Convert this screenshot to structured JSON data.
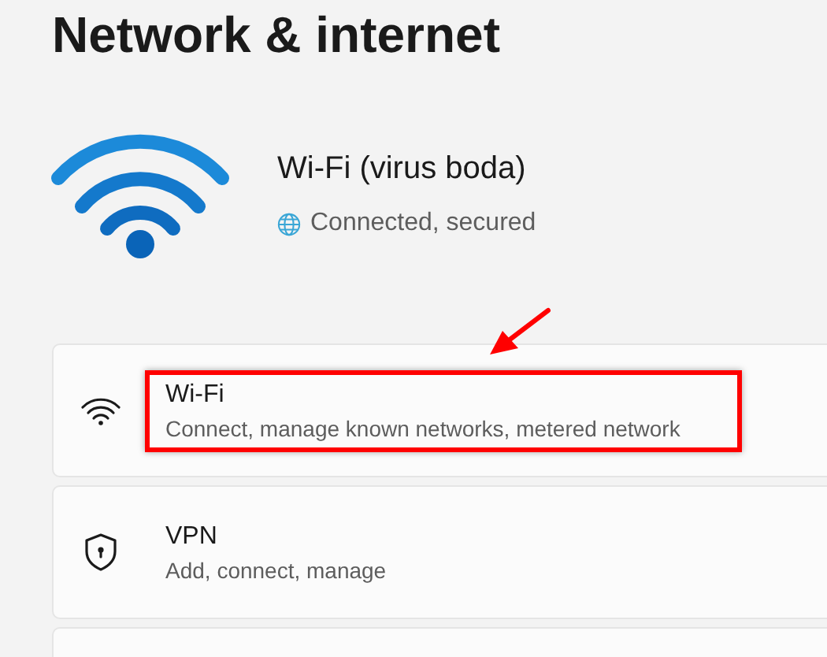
{
  "page_title": "Network & internet",
  "connection": {
    "name": "Wi-Fi (virus boda)",
    "status": "Connected, secured"
  },
  "settings": [
    {
      "kind": "wifi",
      "title": "Wi-Fi",
      "description": "Connect, manage known networks, metered network",
      "highlighted": true
    },
    {
      "kind": "vpn",
      "title": "VPN",
      "description": "Add, connect, manage",
      "highlighted": false
    }
  ]
}
